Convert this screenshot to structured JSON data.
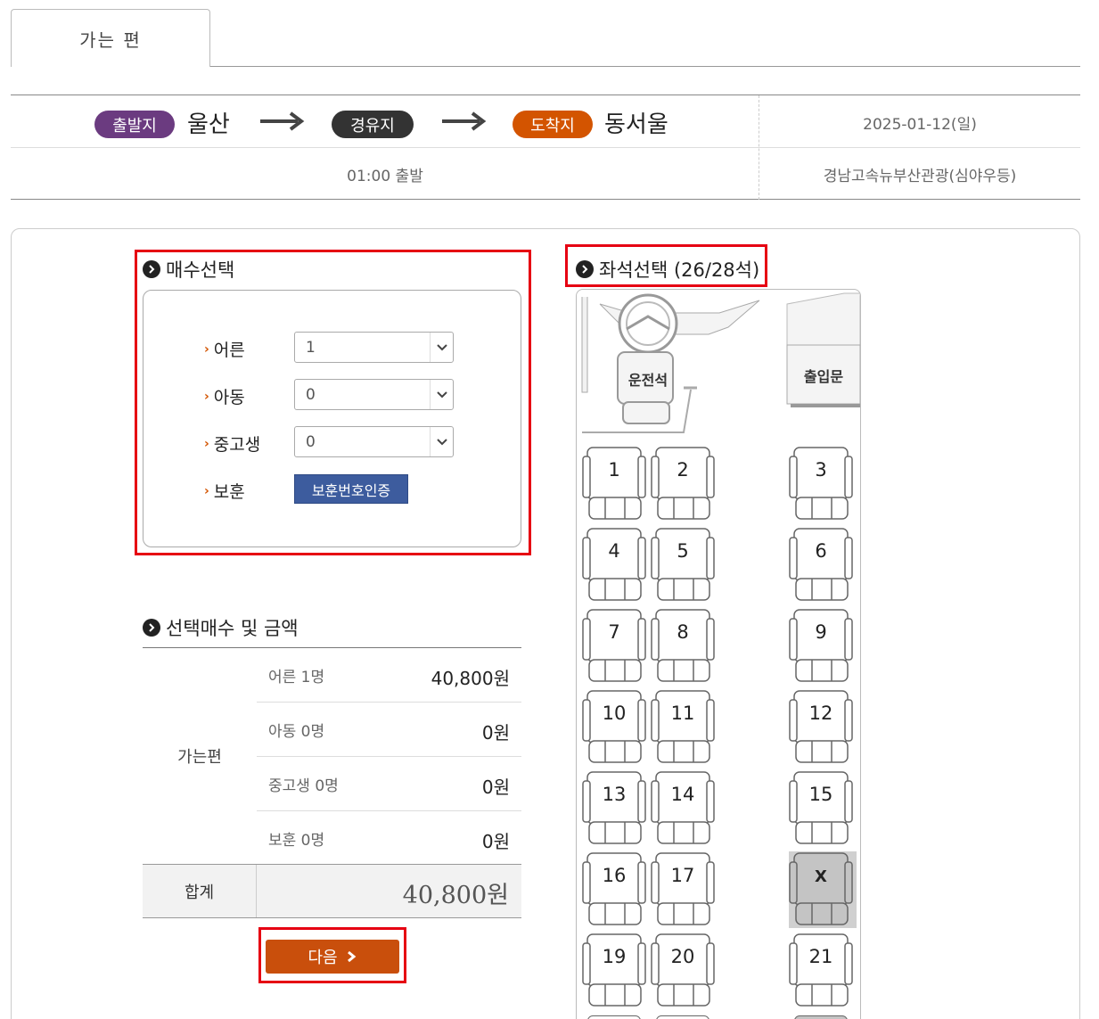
{
  "tab": {
    "label": "가는 편"
  },
  "route": {
    "departure_badge": "출발지",
    "departure_city": "울산",
    "via_badge": "경유지",
    "arrival_badge": "도착지",
    "arrival_city": "동서울",
    "date": "2025-01-12(일)",
    "time": "01:00 출발",
    "company": "경남고속뉴부산관광(심야우등)"
  },
  "quantity": {
    "title": "매수선택",
    "rows": [
      {
        "label": "어른",
        "value": "1"
      },
      {
        "label": "아동",
        "value": "0"
      },
      {
        "label": "중고생",
        "value": "0"
      }
    ],
    "veteran_label": "보훈",
    "veteran_button": "보훈번호인증"
  },
  "price": {
    "title": "선택매수 및 금액",
    "trip_label": "가는편",
    "rows": [
      {
        "label": "어른 1명",
        "value": "40,800원"
      },
      {
        "label": "아동 0명",
        "value": "0원"
      },
      {
        "label": "중고생 0명",
        "value": "0원"
      },
      {
        "label": "보훈 0명",
        "value": "0원"
      }
    ],
    "total_label": "합계",
    "total_value": "40,800원",
    "next_button": "다음"
  },
  "seats": {
    "title": "좌석선택 (26/28석)",
    "driver_label": "운전석",
    "door_label": "출입문",
    "list": [
      {
        "label": "1",
        "taken": false
      },
      {
        "label": "2",
        "taken": false
      },
      {
        "label": "3",
        "taken": false
      },
      {
        "label": "4",
        "taken": false
      },
      {
        "label": "5",
        "taken": false
      },
      {
        "label": "6",
        "taken": false
      },
      {
        "label": "7",
        "taken": false
      },
      {
        "label": "8",
        "taken": false
      },
      {
        "label": "9",
        "taken": false
      },
      {
        "label": "10",
        "taken": false
      },
      {
        "label": "11",
        "taken": false
      },
      {
        "label": "12",
        "taken": false
      },
      {
        "label": "13",
        "taken": false
      },
      {
        "label": "14",
        "taken": false
      },
      {
        "label": "15",
        "taken": false
      },
      {
        "label": "16",
        "taken": false
      },
      {
        "label": "17",
        "taken": false
      },
      {
        "label": "X",
        "taken": true
      },
      {
        "label": "19",
        "taken": false
      },
      {
        "label": "20",
        "taken": false
      },
      {
        "label": "21",
        "taken": false
      }
    ]
  },
  "colors": {
    "departure": "#6b3b80",
    "via": "#333333",
    "arrival": "#d35400",
    "next_button": "#c94f0c",
    "veteran_button": "#3d5c9e",
    "highlight": "#e60012"
  }
}
